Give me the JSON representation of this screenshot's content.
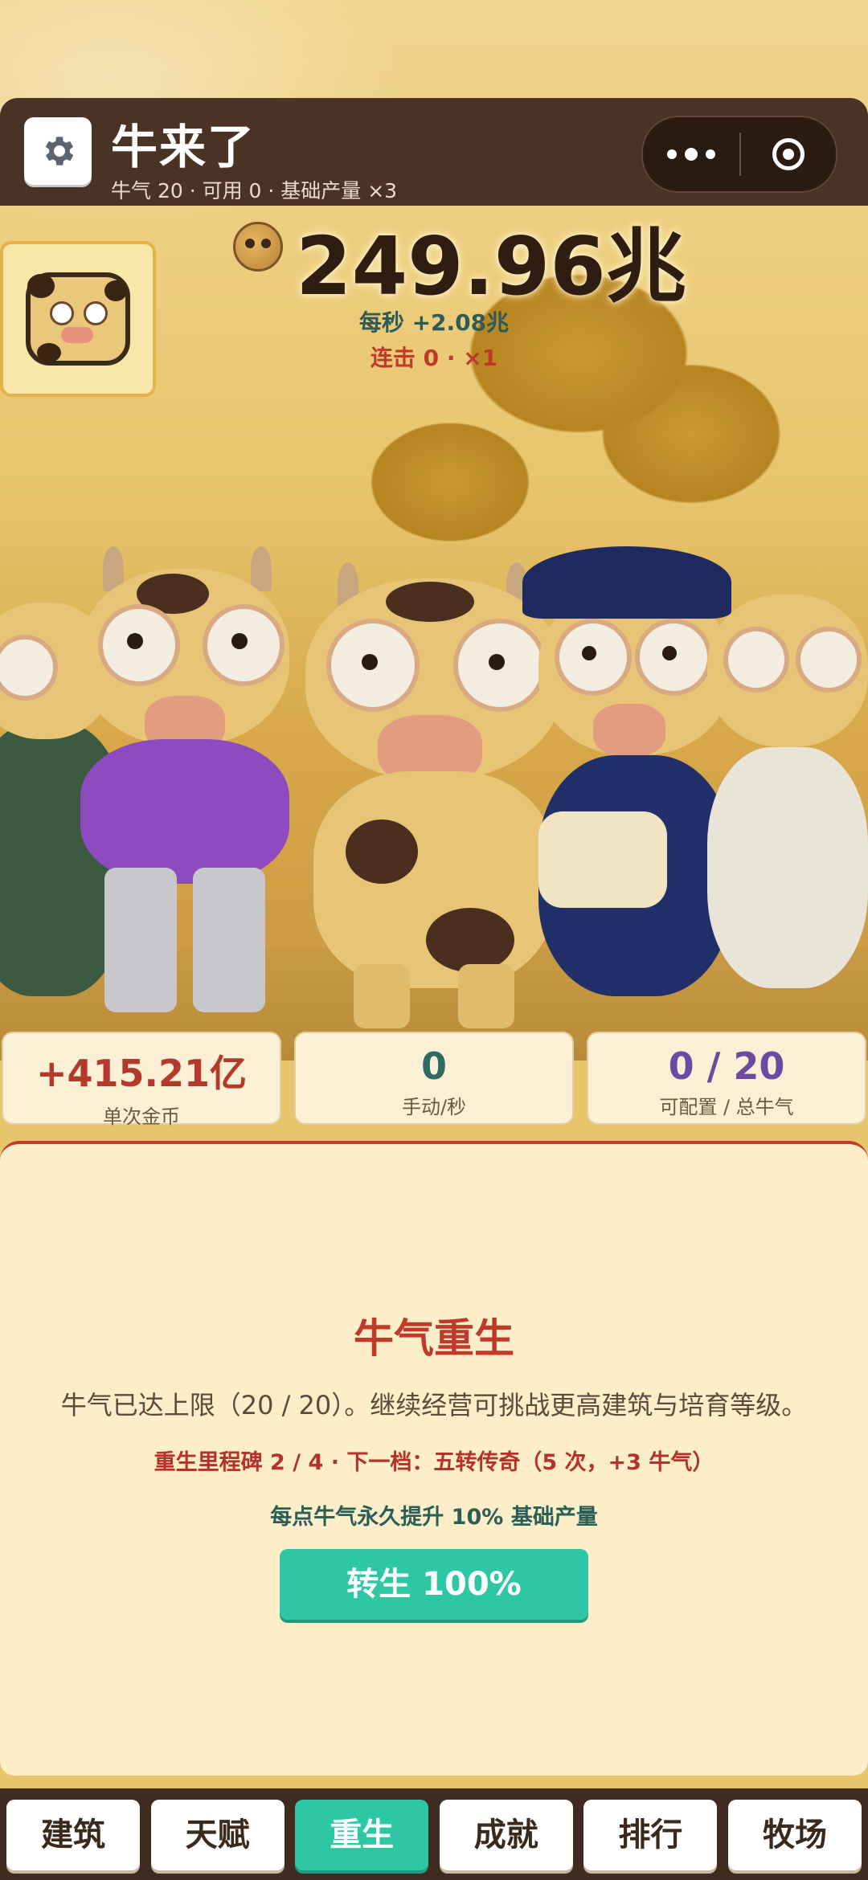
{
  "header": {
    "title": "牛来了",
    "subline": "牛气 20 · 可用 0 · 基础产量 ×3",
    "settings_icon": "gear-icon",
    "more_icon": "more-dots-icon",
    "close_icon": "target-close-icon"
  },
  "coins": {
    "total": "249.96兆",
    "per_second": "每秒 +2.08兆",
    "combo": "连击 0 · ×1"
  },
  "stats": [
    {
      "value": "+415.21亿",
      "label": "单次金币",
      "color": "#b33a2b"
    },
    {
      "value": "0",
      "label": "手动/秒",
      "color": "#2f6b62"
    },
    {
      "value": "0 / 20",
      "label": "可配置 / 总牛气",
      "color": "#6b4aa0"
    }
  ],
  "rebirth": {
    "title": "牛气重生",
    "description": "牛气已达上限（20 / 20）。继续经营可挑战更高建筑与培育等级。",
    "milestone": "重生里程碑 2 / 4 · 下一档：五转传奇（5 次，+3 牛气）",
    "bonus": "每点牛气永久提升 10% 基础产量",
    "button_label": "转生 100%"
  },
  "nav": {
    "items": [
      {
        "label": "建筑",
        "active": false
      },
      {
        "label": "天赋",
        "active": false
      },
      {
        "label": "重生",
        "active": true
      },
      {
        "label": "成就",
        "active": false
      },
      {
        "label": "排行",
        "active": false
      },
      {
        "label": "牧场",
        "active": false
      }
    ]
  }
}
